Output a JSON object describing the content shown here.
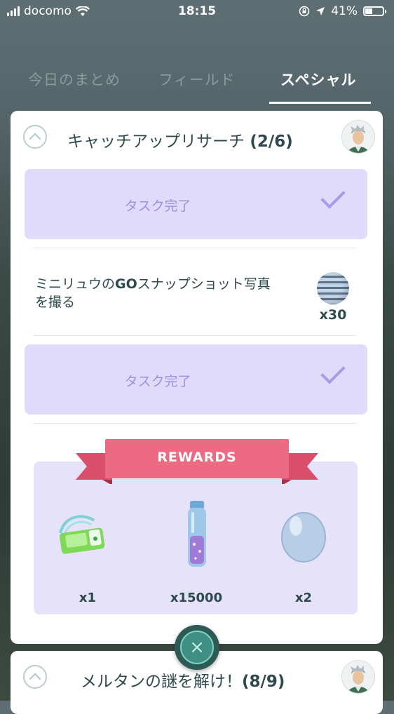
{
  "status_bar": {
    "carrier": "docomo",
    "time": "18:15",
    "battery": "41%",
    "battery_level": 0.41
  },
  "tabs": [
    {
      "label": "今日のまとめ",
      "active": false
    },
    {
      "label": "フィールド",
      "active": false
    },
    {
      "label": "スペシャル",
      "active": true
    }
  ],
  "research": {
    "title": "キャッチアップリサーチ",
    "progress": "(2/6)",
    "task_done_label": "タスク完了",
    "task": {
      "prefix": "ミニリュウの",
      "brand": "GO",
      "suffix": "スナップショット写真を撮る",
      "reward_qty": "x30",
      "reward_icon": "great-ball-icon"
    },
    "rewards_title": "REWARDS",
    "rewards": [
      {
        "icon": "pass-icon",
        "qty": "x1"
      },
      {
        "icon": "stardust-potion-icon",
        "qty": "x15000"
      },
      {
        "icon": "egg-icon",
        "qty": "x2"
      }
    ]
  },
  "next_research": {
    "title": "メルタンの謎を解け！",
    "progress": "(8/9)"
  },
  "colors": {
    "accent": "#2f4a4f",
    "task_done_bg": "#e0dbfa",
    "ribbon": "#e05a75",
    "fab": "#3f8f84"
  },
  "close_button": {
    "glyph": "×"
  }
}
